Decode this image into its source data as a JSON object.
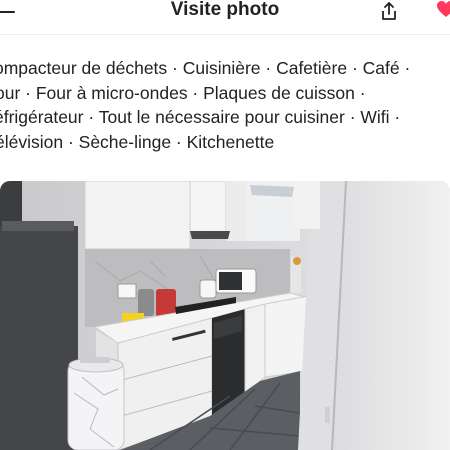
{
  "header": {
    "title": "Visite photo",
    "back_icon": "arrow-left-icon",
    "share_icon": "share-icon",
    "save_icon": "heart-icon",
    "accent_color": "#ff385c"
  },
  "amenities": {
    "lines": [
      "ompacteur de déchets · Cuisinière · Cafetière · Café ·",
      "our · Four à micro-ondes · Plaques de cuisson ·",
      "éfrigérateur · Tout le nécessaire pour cuisiner · Wifi ·",
      "élévision · Sèche-linge · Kitchenette"
    ]
  },
  "photo": {
    "subject": "kitchenette-photo"
  }
}
